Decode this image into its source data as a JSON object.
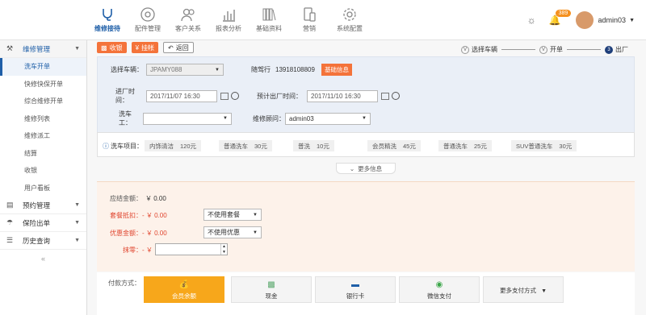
{
  "nav": {
    "items": [
      {
        "label": "维修接待",
        "icon": "stethoscope-icon",
        "active": true
      },
      {
        "label": "配件管理",
        "icon": "wheel-icon",
        "active": false
      },
      {
        "label": "客户关系",
        "icon": "users-icon",
        "active": false
      },
      {
        "label": "报表分析",
        "icon": "bar-chart-icon",
        "active": false
      },
      {
        "label": "基础资料",
        "icon": "books-icon",
        "active": false
      },
      {
        "label": "营销",
        "icon": "devices-icon",
        "active": false
      },
      {
        "label": "系统配置",
        "icon": "gear-icon",
        "active": false
      }
    ],
    "notification_count": "389",
    "username": "admin03"
  },
  "sidebar": {
    "groups": [
      {
        "label": "维修管理"
      },
      {
        "label": "预约管理"
      },
      {
        "label": "保险出单"
      },
      {
        "label": "历史查询"
      }
    ],
    "items": [
      "洗车开单",
      "快修快保开单",
      "综合维修开单",
      "维修列表",
      "维修派工",
      "结算",
      "收银",
      "用户看板"
    ]
  },
  "toolbar": {
    "collect": "收银",
    "charge": "挂帐",
    "back": "返回"
  },
  "steps": [
    "选择车辆",
    "开单",
    "出厂"
  ],
  "form": {
    "vehicle_label": "选择车辆：",
    "vehicle_value": "JPAMY088",
    "driver_label": "随驾行",
    "driver_phone": "13918108809",
    "basic_info_btn": "基础信息",
    "entry_time_label": "进厂时间：",
    "entry_time": "2017/11/07 16:30",
    "exit_time_label": "预计出厂时间：",
    "exit_time": "2017/11/10 16:30",
    "washer_label": "洗车工：",
    "washer_value": "",
    "advisor_label": "维修顾问：",
    "advisor_value": "admin03"
  },
  "services": {
    "label": "洗车项目：",
    "items": [
      {
        "name": "内饰清洁",
        "price": "120元"
      },
      {
        "name": "普通洗车",
        "price": "30元"
      },
      {
        "name": "普洗",
        "price": "10元"
      },
      {
        "name": "会员精洗",
        "price": "45元"
      },
      {
        "name": "普通洗车",
        "price": "25元"
      },
      {
        "name": "SUV普通洗车",
        "price": "30元"
      }
    ],
    "more": "更多信息"
  },
  "payment": {
    "receivable_label": "应结金额：",
    "receivable_value": "￥ 0.00",
    "package_label": "套餐抵扣：",
    "package_value": "- ￥ 0.00",
    "package_select": "不使用套餐",
    "discount_label": "优惠金额：",
    "discount_value": "- ￥ 0.00",
    "discount_select": "不使用优惠",
    "wipe_label": "抹零：",
    "wipe_prefix": "- ￥",
    "method_label": "付款方式：",
    "methods": [
      "会员余额",
      "现金",
      "银行卡",
      "微信支付",
      "更多支付方式"
    ]
  },
  "colors": {
    "primary": "#1f5fa8",
    "accent": "#f4733a",
    "member_pay": "#f7a71b"
  }
}
